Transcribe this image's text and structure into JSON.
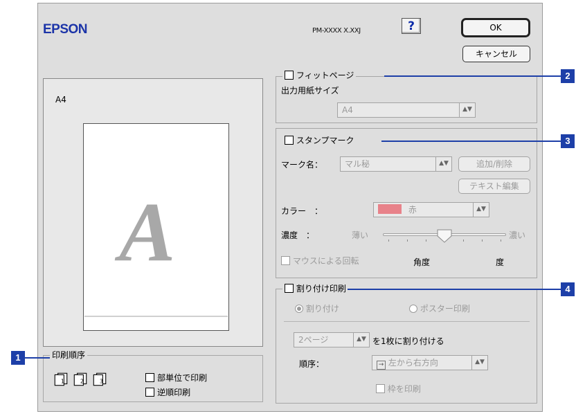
{
  "header": {
    "brand": "EPSON",
    "model": "PM-XXXX X.XXJ",
    "help_label": "?",
    "ok_label": "OK",
    "cancel_label": "キャンセル"
  },
  "preview": {
    "paper_size": "A4",
    "sample_glyph": "A"
  },
  "print_order": {
    "title": "印刷順序",
    "collate_label": "部単位で印刷",
    "reverse_label": "逆順印刷",
    "icons": [
      "page-order-1-icon",
      "page-order-2-icon",
      "page-order-3-icon"
    ]
  },
  "fit_page": {
    "title": "フィットページ",
    "output_label": "出力用紙サイズ",
    "output_value": "A4"
  },
  "stamp": {
    "title": "スタンプマーク",
    "mark_name_label": "マーク名：",
    "mark_name_value": "マル秘",
    "add_delete_label": "追加/削除",
    "text_edit_label": "テキスト編集",
    "color_label": "カラー　：",
    "color_value": "赤",
    "color_swatch": "#e8828a",
    "density_label": "濃度　：",
    "density_low": "薄い",
    "density_high": "濃い",
    "density_level": 0.5,
    "mouse_rotate_label": "マウスによる回転",
    "angle_label": "角度",
    "degree_label": "度"
  },
  "layout": {
    "title": "割り付け印刷",
    "nup_label": "割り付け",
    "poster_label": "ポスター印刷",
    "pages_value": "2ページ",
    "pages_suffix": "を1枚に割り付ける",
    "order_label": "順序：",
    "order_value": "左から右方向",
    "border_label": "枠を印刷"
  },
  "callouts": [
    "1",
    "2",
    "3",
    "4"
  ],
  "colors": {
    "callout": "#1d3fa8",
    "brand": "#1c34a8",
    "dialog_bg": "#dedede"
  }
}
